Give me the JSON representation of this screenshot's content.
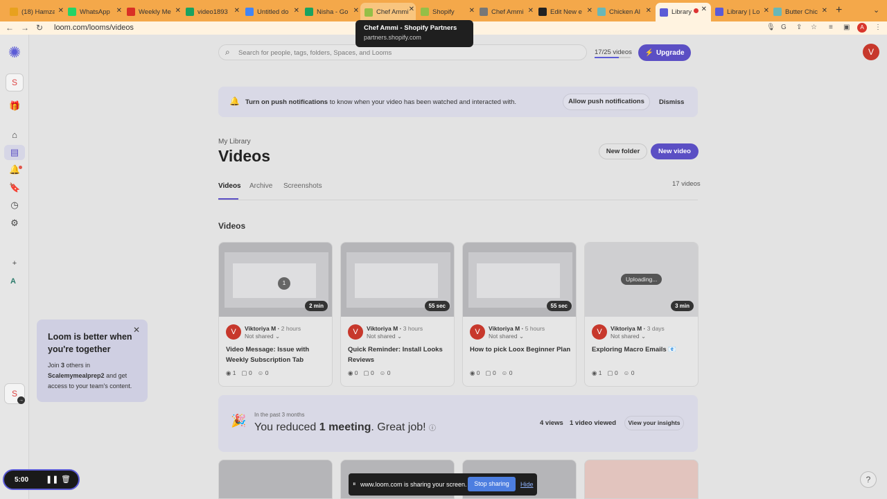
{
  "browser": {
    "tabs": [
      {
        "label": "(18) Hamza",
        "color": "#e8a11e"
      },
      {
        "label": "WhatsApp",
        "color": "#25d366"
      },
      {
        "label": "Weekly Me",
        "color": "#d93025"
      },
      {
        "label": "video1893",
        "color": "#1aa260"
      },
      {
        "label": "Untitled do",
        "color": "#4285f4"
      },
      {
        "label": "Nisha - Go",
        "color": "#1aa260"
      },
      {
        "label": "Chef Ammi",
        "color": "#95bf47"
      },
      {
        "label": "Shopify",
        "color": "#95bf47"
      },
      {
        "label": "Chef Ammi",
        "color": "#777777"
      },
      {
        "label": "Edit New e",
        "color": "#222222"
      },
      {
        "label": "Chicken Al",
        "color": "#69b7b7"
      },
      {
        "label": "Library",
        "color": "#5b5bd6"
      },
      {
        "label": "Library | Lo",
        "color": "#5b5bd6"
      },
      {
        "label": "Butter Chic",
        "color": "#69b7b7"
      }
    ],
    "url": "loom.com/looms/videos",
    "profile_initial": "A",
    "tooltip": {
      "title": "Chef Ammi - Shopify Partners",
      "domain": "partners.shopify.com"
    }
  },
  "sidebar": {
    "workspace_initial": "S",
    "bottom_initial": "S",
    "a_label": "A"
  },
  "header": {
    "search_placeholder": "Search for people, tags, folders, Spaces, and Looms",
    "video_count": "17/25 videos",
    "video_progress": 0.68,
    "upgrade": "Upgrade",
    "avatar": "V"
  },
  "banner": {
    "bold": "Turn on push notifications",
    "rest": " to know when your video has been watched and interacted with.",
    "allow": "Allow push notifications",
    "dismiss": "Dismiss"
  },
  "library": {
    "breadcrumb": "My Library",
    "title": "Videos",
    "new_folder": "New folder",
    "new_video": "New video",
    "tabs": [
      "Videos",
      "Archive",
      "Screenshots"
    ],
    "count": "17 videos",
    "section": "Videos"
  },
  "videos": [
    {
      "author": "Viktoriya M",
      "age": "2 hours",
      "share": "Not shared",
      "title": "Video Message: Issue with Weekly Subscription Tab",
      "duration": "2 min",
      "views": "1",
      "comments": "0",
      "reactions": "0"
    },
    {
      "author": "Viktoriya M",
      "age": "3 hours",
      "share": "Not shared",
      "title": "Quick Reminder: Install Looks Reviews",
      "duration": "55 sec",
      "views": "0",
      "comments": "0",
      "reactions": "0"
    },
    {
      "author": "Viktoriya M",
      "age": "5 hours",
      "share": "Not shared",
      "title": "How to pick Loox Beginner Plan",
      "duration": "55 sec",
      "views": "0",
      "comments": "0",
      "reactions": "0"
    },
    {
      "author": "Viktoriya M",
      "age": "3 days",
      "share": "Not shared",
      "title": "Exploring Macro Emails 📧",
      "duration": "3 min",
      "views": "1",
      "comments": "0",
      "reactions": "0",
      "status": "Uploading..."
    }
  ],
  "insight": {
    "period": "In the past 3 months",
    "pre": "You reduced ",
    "bold": "1 meeting",
    "post": ". Great job!",
    "views": "4 views",
    "viewed": "1 video viewed",
    "button": "View your insights"
  },
  "promo": {
    "heading": "Loom is better when you're together",
    "pre": "Join ",
    "count": "3",
    "mid": " others in ",
    "workspace": "Scalemymealprep2",
    "post": " and get access to your team's content."
  },
  "recorder": {
    "time": "5:00"
  },
  "share_bar": {
    "message": "www.loom.com is sharing your screen.",
    "stop": "Stop sharing",
    "hide": "Hide"
  }
}
